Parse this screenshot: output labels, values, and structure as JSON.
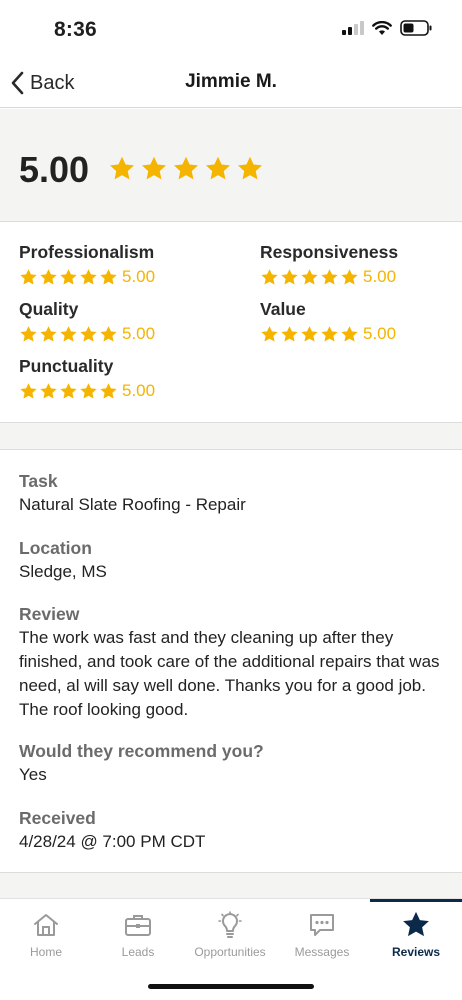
{
  "status_bar": {
    "time": "8:36"
  },
  "nav": {
    "back_label": "Back",
    "title": "Jimmie M."
  },
  "overall": {
    "rating": "5.00",
    "stars": 5
  },
  "categories": [
    {
      "label": "Professionalism",
      "value": "5.00",
      "stars": 5
    },
    {
      "label": "Responsiveness",
      "value": "5.00",
      "stars": 5
    },
    {
      "label": "Quality",
      "value": "5.00",
      "stars": 5
    },
    {
      "label": "Value",
      "value": "5.00",
      "stars": 5
    },
    {
      "label": "Punctuality",
      "value": "5.00",
      "stars": 5
    }
  ],
  "details": {
    "task_label": "Task",
    "task_value": "Natural Slate Roofing - Repair",
    "location_label": "Location",
    "location_value": "Sledge, MS",
    "review_label": "Review",
    "review_value": "The work was fast and they cleaning up after they finished, and took care of the additional repairs that was need, al will say well done. Thanks you for a good job. The roof looking good.",
    "recommend_label": "Would they recommend you?",
    "recommend_value": "Yes",
    "received_label": "Received",
    "received_value": "4/28/24 @ 7:00 PM CDT"
  },
  "tabs": [
    {
      "label": "Home",
      "icon": "home-icon"
    },
    {
      "label": "Leads",
      "icon": "briefcase-icon"
    },
    {
      "label": "Opportunities",
      "icon": "lightbulb-icon"
    },
    {
      "label": "Messages",
      "icon": "chat-icon"
    },
    {
      "label": "Reviews",
      "icon": "star-icon",
      "active": true
    }
  ],
  "colors": {
    "star": "#f5b400",
    "accent": "#0b2a4a",
    "muted": "#9a9a9a"
  }
}
